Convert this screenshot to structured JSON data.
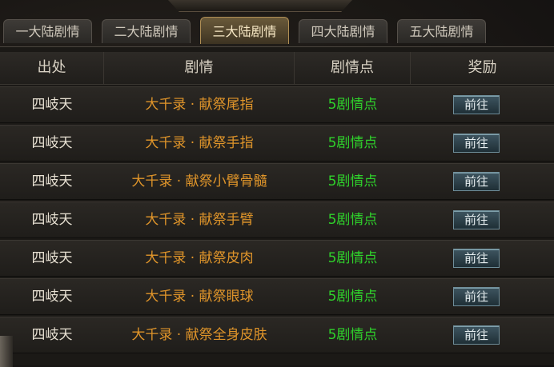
{
  "tabs": [
    {
      "label": "一大陆剧情"
    },
    {
      "label": "二大陆剧情"
    },
    {
      "label": "三大陆剧情"
    },
    {
      "label": "四大陆剧情"
    },
    {
      "label": "五大陆剧情"
    }
  ],
  "active_tab": 2,
  "table": {
    "headers": {
      "source": "出处",
      "story": "剧情",
      "points": "剧情点",
      "reward": "奖励"
    },
    "rows": [
      {
        "source": "四岐天",
        "story": "大千录 · 献祭尾指",
        "points": "5剧情点",
        "action": "前往"
      },
      {
        "source": "四岐天",
        "story": "大千录 · 献祭手指",
        "points": "5剧情点",
        "action": "前往"
      },
      {
        "source": "四岐天",
        "story": "大千录 · 献祭小臂骨髓",
        "points": "5剧情点",
        "action": "前往"
      },
      {
        "source": "四岐天",
        "story": "大千录 · 献祭手臂",
        "points": "5剧情点",
        "action": "前往"
      },
      {
        "source": "四岐天",
        "story": "大千录 · 献祭皮肉",
        "points": "5剧情点",
        "action": "前往"
      },
      {
        "source": "四岐天",
        "story": "大千录 · 献祭眼球",
        "points": "5剧情点",
        "action": "前往"
      },
      {
        "source": "四岐天",
        "story": "大千录 · 献祭全身皮肤",
        "points": "5剧情点",
        "action": "前往"
      }
    ]
  },
  "colors": {
    "story": "#e0952a",
    "points": "#2fd12b",
    "active_tab_border": "#b08f55"
  }
}
